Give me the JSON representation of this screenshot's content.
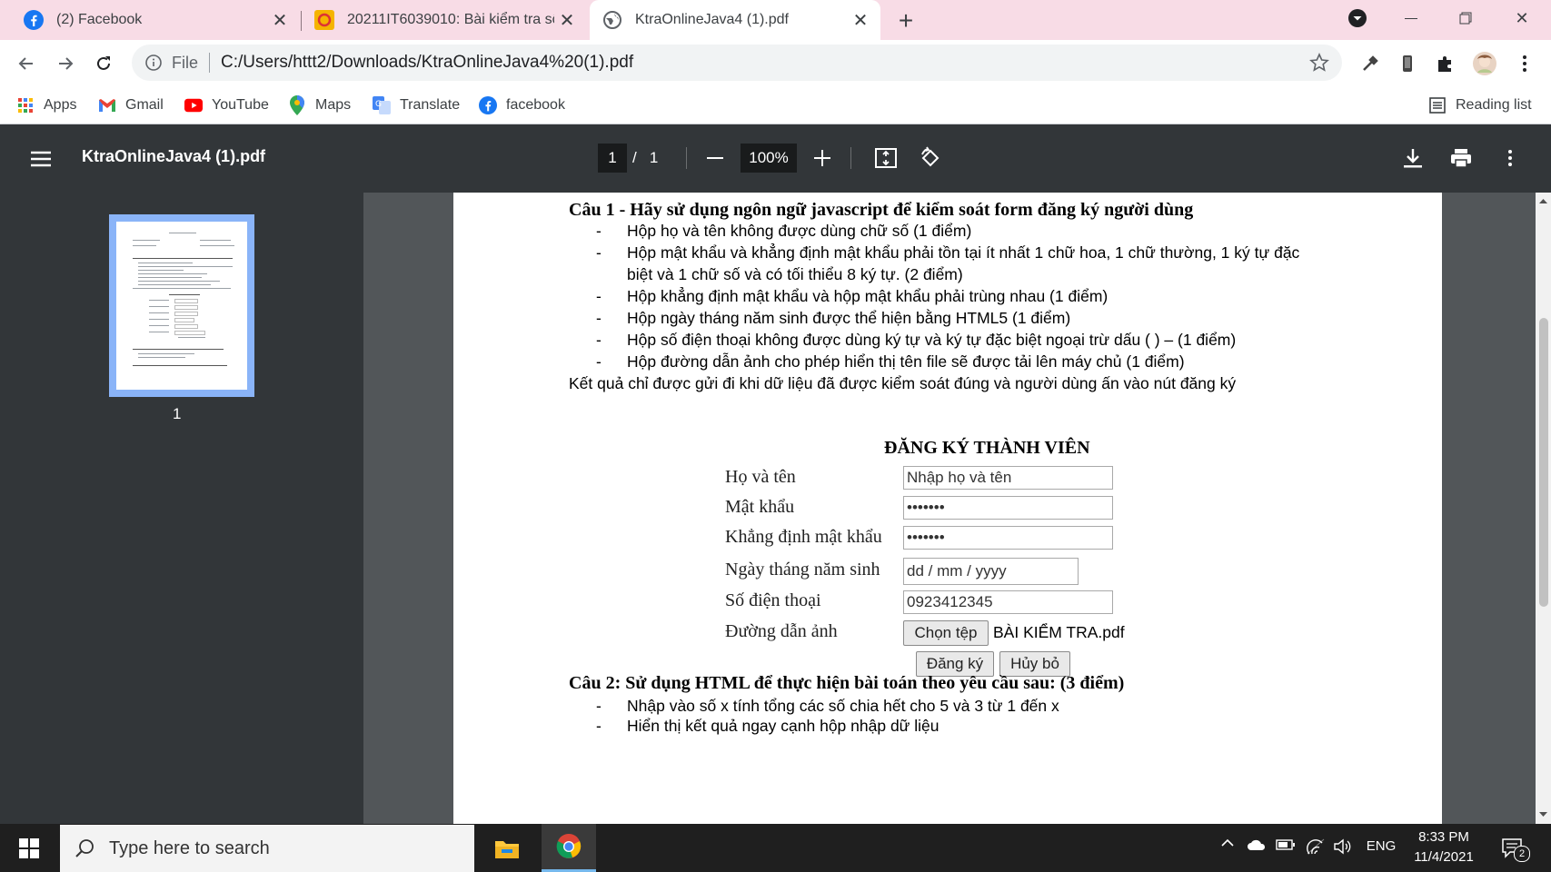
{
  "tabs": [
    {
      "title": "(2) Facebook",
      "active": false
    },
    {
      "title": "20211IT6039010: Bài kiểm tra số",
      "active": false
    },
    {
      "title": "KtraOnlineJava4 (1).pdf",
      "active": true
    }
  ],
  "address": {
    "scheme_label": "File",
    "url": "C:/Users/httt2/Downloads/KtraOnlineJava4%20(1).pdf"
  },
  "bookmarks": [
    "Apps",
    "Gmail",
    "YouTube",
    "Maps",
    "Translate",
    "facebook"
  ],
  "reading_list": "Reading list",
  "pdf_toolbar": {
    "title": "KtraOnlineJava4 (1).pdf",
    "current_page": "1",
    "page_separator": "/",
    "total_pages": "1",
    "zoom": "100%"
  },
  "sidebar": {
    "thumbnail_label": "1"
  },
  "document": {
    "q1_title": "Câu 1 - Hãy sử dụng ngôn ngữ javascript để kiểm soát form đăng ký người dùng",
    "q1_items": [
      "Hộp họ và tên không được dùng chữ số (1 điểm)",
      "Hộp mật khẩu và khẳng định mật khẩu phải tồn tại ít nhất 1 chữ hoa, 1 chữ thường, 1 ký tự đặc",
      "biệt và 1 chữ số và có tối thiểu 8 ký tự. (2 điểm)",
      "Hộp khẳng định mật khẩu và hộp mật khẩu phải trùng nhau (1 điểm)",
      "Hộp ngày tháng năm sinh được thể hiện bằng HTML5 (1 điểm)",
      "Hộp số điện thoại không được dùng ký tự và ký tự đặc biệt ngoại trừ dấu ( ) – (1 điểm)",
      "Hộp đường dẫn ảnh cho phép hiển thị tên file sẽ được tải lên máy chủ (1 điểm)"
    ],
    "q1_note": "Kết quả chỉ được gửi đi khi dữ liệu đã được kiểm soát đúng và người dùng ấn vào nút đăng ký",
    "form": {
      "title": "ĐĂNG KÝ THÀNH VIÊN",
      "labels": [
        "Họ và tên",
        "Mật khẩu",
        "Khẳng định mật khẩu",
        "Ngày tháng năm sinh",
        "Số điện thoại",
        "Đường dẫn ảnh"
      ],
      "name_value": "Nhập họ và tên",
      "password_value": "•••••••",
      "confirm_value": "•••••••",
      "date_value": "dd / mm / yyyy",
      "phone_value": "0923412345",
      "file_button": "Chọn tệp",
      "file_name": "BÀI KIỂM TRA.pdf",
      "submit": "Đăng ký",
      "cancel": "Hủy bỏ"
    },
    "q2_title": "Câu 2: Sử dụng HTML để thực hiện bài toán theo yêu cầu sau: (3 điểm)",
    "q2_items": [
      "Nhập vào số x tính tổng các số chia hết cho 5 và 3 từ 1 đến x",
      "Hiển thị kết quả ngay cạnh hộp nhập dữ liệu"
    ]
  },
  "taskbar": {
    "search_placeholder": "Type here to search",
    "language": "ENG",
    "time": "8:33 PM",
    "date": "11/4/2021",
    "notification_count": "2"
  },
  "colors": {
    "tabstrip": "#f8dce6",
    "pdf_toolbar": "#323639",
    "viewer_bg": "#525659",
    "thumb_highlight": "#8ab4f8"
  }
}
